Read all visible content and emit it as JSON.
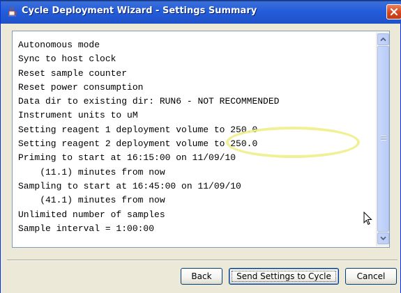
{
  "window": {
    "title": "Cycle Deployment Wizard - Settings Summary",
    "icon": "java-cup-icon",
    "close_icon": "close-icon"
  },
  "summary": {
    "lines": [
      "Autonomous mode",
      "Sync to host clock",
      "Reset sample counter",
      "Reset power consumption",
      "Data dir to existing dir: RUN6 - NOT RECOMMENDED",
      "Instrument units to uM",
      "Setting reagent 1 deployment volume to 250.0",
      "Setting reagent 2 deployment volume to 250.0",
      "Priming to start at 16:15:00 on 11/09/10",
      "    (11.1) minutes from now",
      "Sampling to start at 16:45:00 on 11/09/10",
      "    (41.1) minutes from now",
      "Unlimited number of samples",
      "Sample interval = 1:00:00"
    ],
    "highlight_color": "#f0ee8a"
  },
  "buttons": {
    "back": "Back",
    "send": "Send Settings to Cycle",
    "cancel": "Cancel"
  },
  "colors": {
    "titlebar": "#245edb",
    "dialog_bg": "#ece9d8",
    "close_button": "#d6451e"
  }
}
